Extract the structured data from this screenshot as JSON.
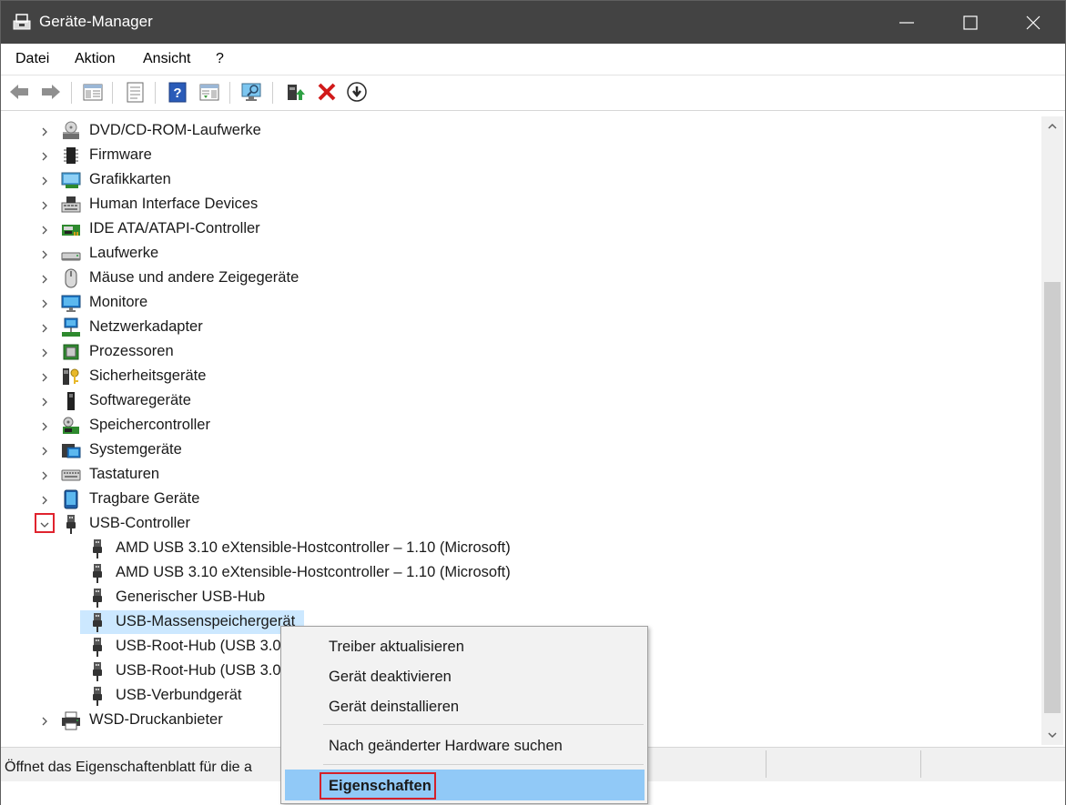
{
  "window": {
    "title": "Geräte-Manager"
  },
  "menu": [
    "Datei",
    "Aktion",
    "Ansicht",
    "?"
  ],
  "toolbar": {
    "icons": [
      "back-arrow-icon",
      "forward-arrow-icon",
      "show-hide-tree-icon",
      "properties-icon",
      "help-icon",
      "action-pane-icon",
      "scan-hardware-icon",
      "update-driver-icon",
      "uninstall-icon",
      "disable-device-icon"
    ]
  },
  "tree": {
    "categories": [
      {
        "label": "DVD/CD-ROM-Laufwerke",
        "icon": "dvd-drive-icon"
      },
      {
        "label": "Firmware",
        "icon": "firmware-chip-icon"
      },
      {
        "label": "Grafikkarten",
        "icon": "display-adapter-icon"
      },
      {
        "label": "Human Interface Devices",
        "icon": "hid-keyboard-icon"
      },
      {
        "label": "IDE ATA/ATAPI-Controller",
        "icon": "ide-controller-icon"
      },
      {
        "label": "Laufwerke",
        "icon": "disk-drive-icon"
      },
      {
        "label": "Mäuse und andere Zeigegeräte",
        "icon": "mouse-icon"
      },
      {
        "label": "Monitore",
        "icon": "monitor-icon"
      },
      {
        "label": "Netzwerkadapter",
        "icon": "network-adapter-icon"
      },
      {
        "label": "Prozessoren",
        "icon": "processor-icon"
      },
      {
        "label": "Sicherheitsgeräte",
        "icon": "security-key-icon"
      },
      {
        "label": "Softwaregeräte",
        "icon": "software-device-icon"
      },
      {
        "label": "Speichercontroller",
        "icon": "storage-controller-icon"
      },
      {
        "label": "Systemgeräte",
        "icon": "system-device-icon"
      },
      {
        "label": "Tastaturen",
        "icon": "keyboard-icon"
      },
      {
        "label": "Tragbare Geräte",
        "icon": "portable-device-icon"
      }
    ],
    "usb": {
      "label": "USB-Controller",
      "children": [
        "AMD USB 3.10 eXtensible-Hostcontroller – 1.10 (Microsoft)",
        "AMD USB 3.10 eXtensible-Hostcontroller – 1.10 (Microsoft)",
        "Generischer USB-Hub",
        "USB-Massenspeichergerät",
        "USB-Root-Hub (USB 3.0",
        "USB-Root-Hub (USB 3.0",
        "USB-Verbundgerät"
      ],
      "selected": "USB-Massenspeichergerät"
    },
    "after": [
      {
        "label": "WSD-Druckanbieter",
        "icon": "printer-icon"
      }
    ]
  },
  "context_menu": {
    "items": [
      "Treiber aktualisieren",
      "Gerät deaktivieren",
      "Gerät deinstallieren",
      "Nach geänderter Hardware suchen",
      "Eigenschaften"
    ],
    "highlighted": "Eigenschaften"
  },
  "status": {
    "text": "Öffnet das Eigenschaftenblatt für die a"
  },
  "colors": {
    "titlebar": "#434343",
    "selection": "#cce8ff",
    "menu_highlight": "#91c9f7",
    "annotation_red": "#d4202a"
  }
}
